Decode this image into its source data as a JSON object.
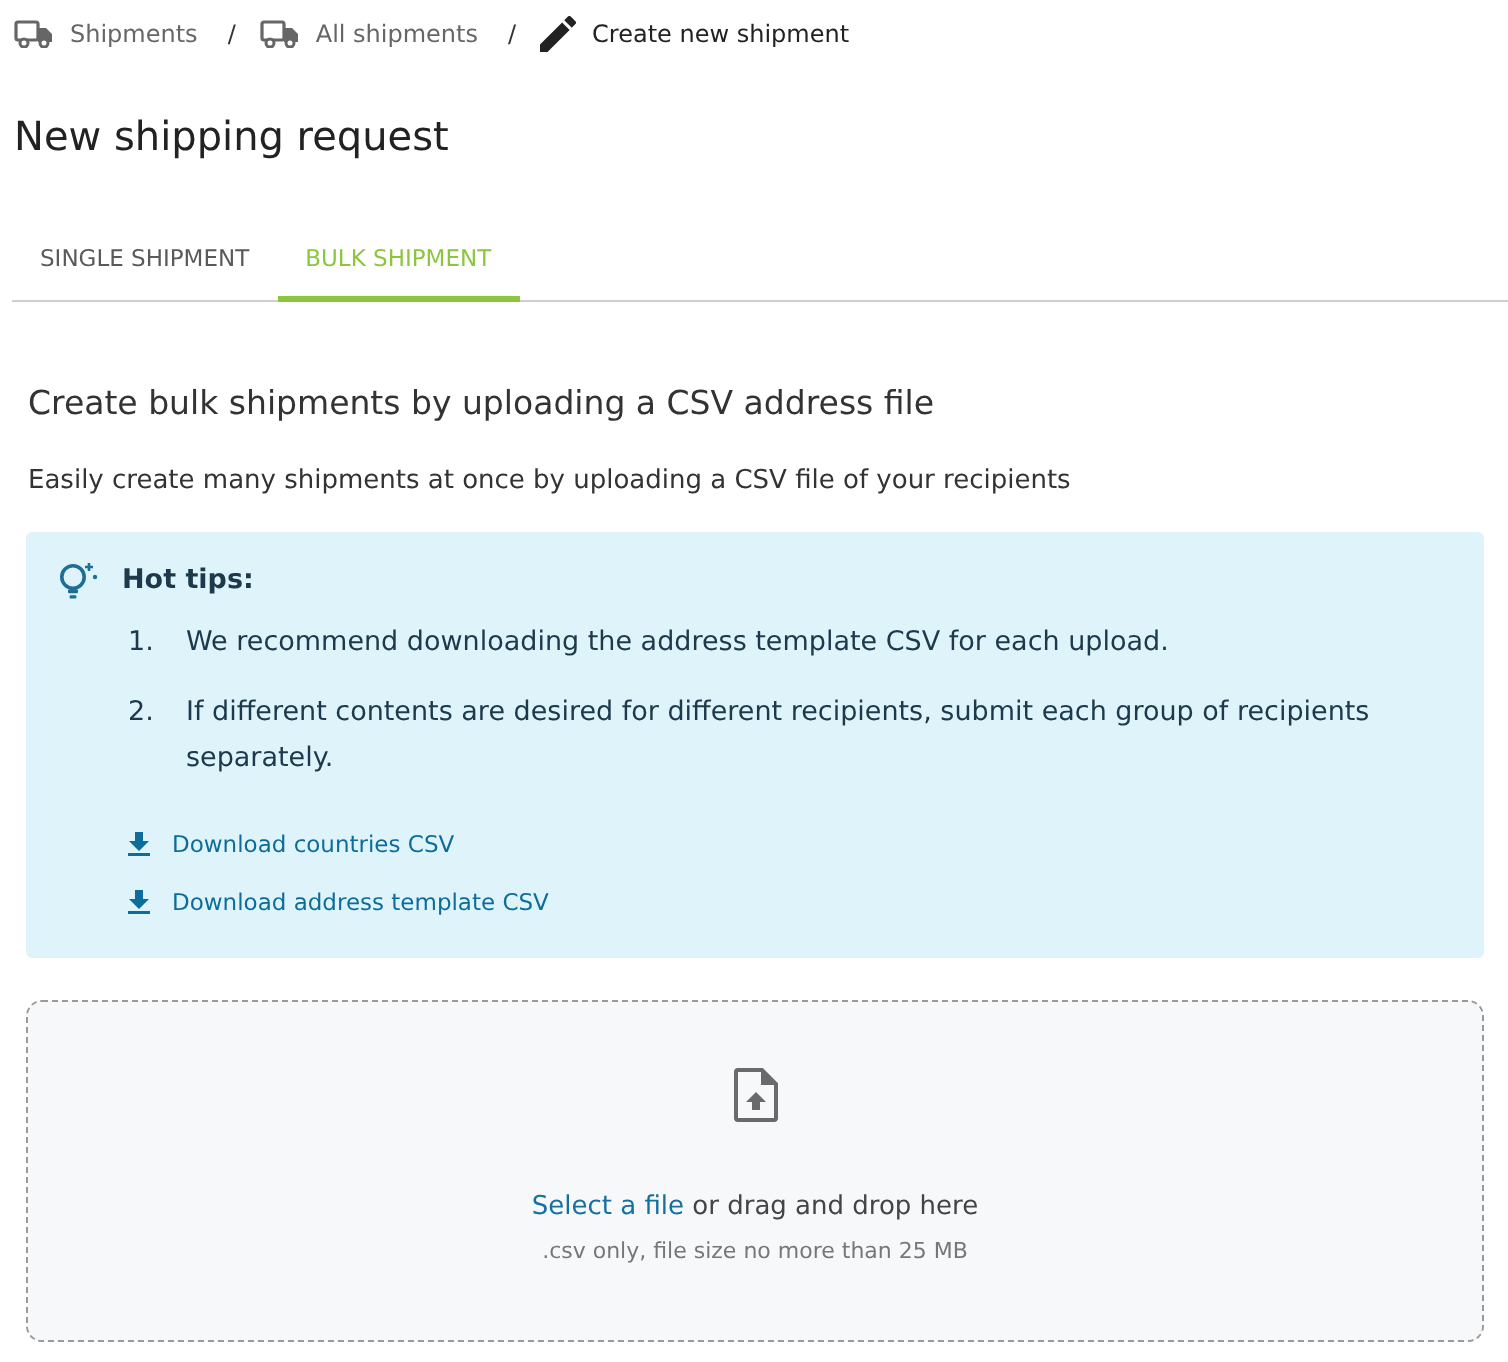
{
  "breadcrumb": [
    {
      "kind": "truck",
      "label": "Shipments",
      "current": false
    },
    {
      "kind": "truck",
      "separator": "/",
      "label": "All shipments",
      "current": false
    },
    {
      "kind": "pencil",
      "separator": "/",
      "label": "Create new shipment",
      "current": true
    }
  ],
  "title": "New shipping request",
  "tabs": [
    {
      "label": "SINGLE SHIPMENT",
      "selected": false
    },
    {
      "label": "BULK SHIPMENT",
      "selected": true
    }
  ],
  "section": {
    "heading": "Create bulk shipments by uploading a CSV address file",
    "description": "Easily create many shipments at once by uploading a CSV file of your recipients",
    "tips": {
      "title": "Hot tips:",
      "items": [
        {
          "number": "1.",
          "text": "We recommend downloading the address template CSV for each upload."
        },
        {
          "number": "2.",
          "text": "If different contents are desired for different recipients, submit each group of recipients separately."
        }
      ],
      "links": [
        {
          "label": "Download countries CSV"
        },
        {
          "label": "Download address template CSV"
        }
      ]
    },
    "upload": {
      "link": "Select a file",
      "text": "or drag and drop here",
      "hint": ".csv only, file size no more than 25 MB"
    }
  }
}
